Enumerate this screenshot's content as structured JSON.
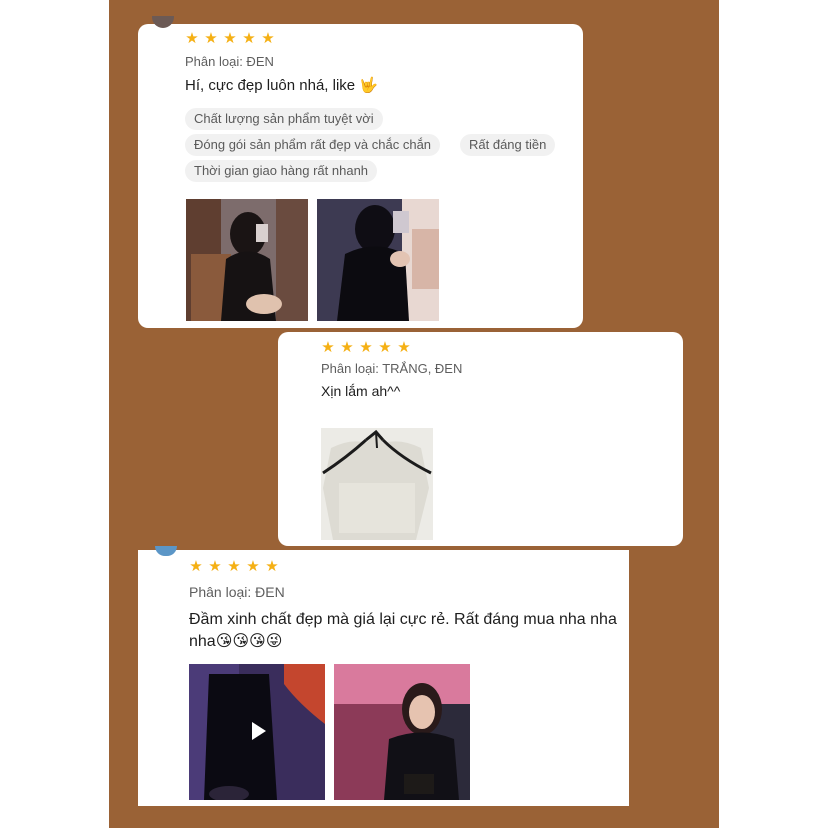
{
  "reviews": [
    {
      "rating": 5,
      "variant": "Phân loại: ĐEN",
      "comment": "Hí, cực đẹp luôn nhá, like 🤟",
      "tags": [
        "Chất lượng sản phẩm tuyệt vời",
        "Đóng gói sản phẩm rất đẹp và chắc chắn",
        "Rất đáng tiền",
        "Thời gian giao hàng rất nhanh"
      ],
      "photos": [
        "mirror-selfie-photo",
        "mirror-selfie-photo"
      ]
    },
    {
      "rating": 5,
      "variant": "Phân loại: TRẮNG, ĐEN",
      "comment": "Xịn lắm ah^^",
      "photos": [
        "product-dress-photo"
      ]
    },
    {
      "rating": 5,
      "variant": "Phân loại: ĐEN",
      "comment": "Đầm xinh chất đẹp mà giá lại cực rẻ. Rất đáng mua nha nha nha😘😘😘😜",
      "photos": [
        "video-thumbnail",
        "customer-photo"
      ]
    }
  ],
  "icons": {
    "star": "star-icon",
    "play": "play-icon"
  },
  "colors": {
    "background": "#9a6236",
    "star": "#f5b014",
    "card": "#ffffff",
    "tag_bg": "#f1f1f1"
  }
}
